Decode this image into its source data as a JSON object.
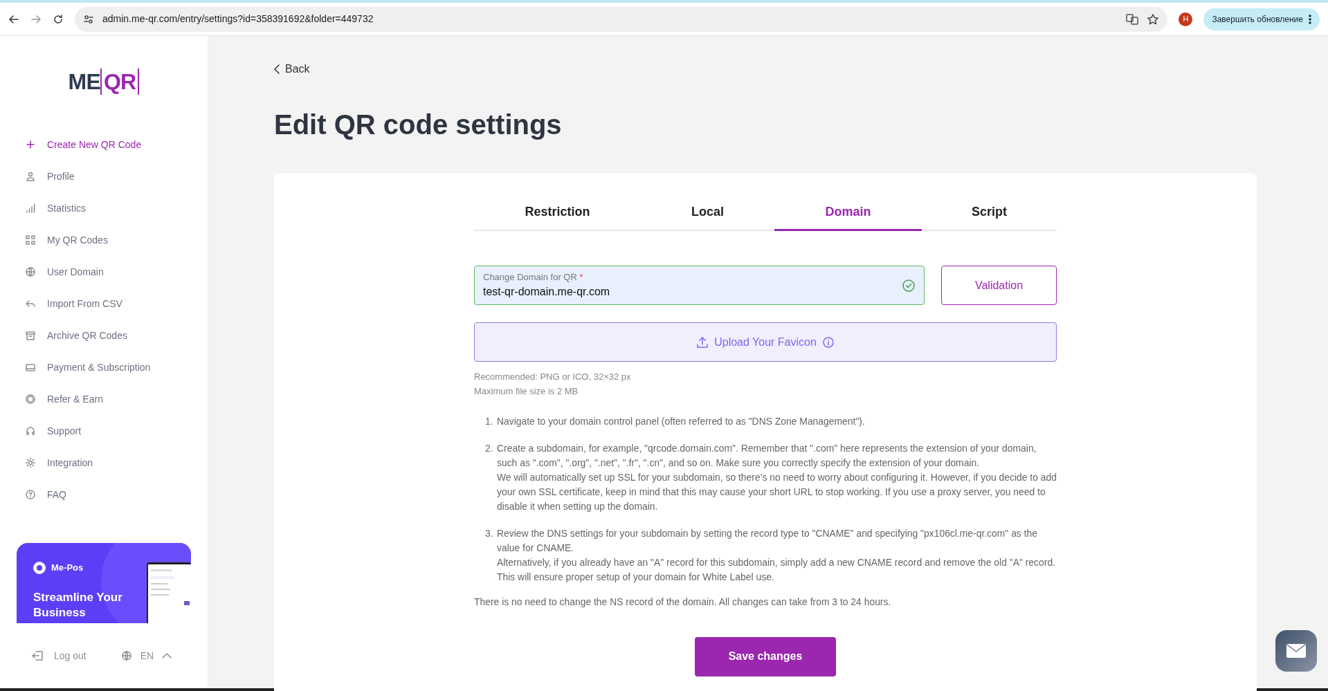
{
  "browser": {
    "url": "admin.me-qr.com/entry/settings?id=358391692&folder=449732",
    "profile_initial": "H",
    "update_button": "Завершить обновление"
  },
  "sidebar": {
    "logo": {
      "left": "ME",
      "right": "QR"
    },
    "items": [
      {
        "label": "Create New QR Code",
        "selected": true
      },
      {
        "label": "Profile",
        "selected": false
      },
      {
        "label": "Statistics",
        "selected": false
      },
      {
        "label": "My QR Codes",
        "selected": false
      },
      {
        "label": "User Domain",
        "selected": false
      },
      {
        "label": "Import From CSV",
        "selected": false
      },
      {
        "label": "Archive QR Codes",
        "selected": false
      },
      {
        "label": "Payment & Subscription",
        "selected": false
      },
      {
        "label": "Refer & Earn",
        "selected": false
      },
      {
        "label": "Support",
        "selected": false
      },
      {
        "label": "Integration",
        "selected": false
      },
      {
        "label": "FAQ",
        "selected": false
      }
    ],
    "promo": {
      "brand": "Me-Pos",
      "headline": "Streamline Your Business"
    },
    "logout": "Log out",
    "language": "EN"
  },
  "back": "Back",
  "title": "Edit QR code settings",
  "tabs": [
    {
      "label": "Restriction",
      "selected": false
    },
    {
      "label": "Local",
      "selected": false
    },
    {
      "label": "Domain",
      "selected": true
    },
    {
      "label": "Script",
      "selected": false
    }
  ],
  "domain_field": {
    "label": "Change Domain for QR",
    "required_mark": "*",
    "value": "test-qr-domain.me-qr.com",
    "valid": true
  },
  "validation_button": "Validation",
  "upload_button": "Upload Your Favicon",
  "upload_notes": [
    "Recommended: PNG or ICO, 32×32 px",
    "Maximum file size is 2 MB"
  ],
  "steps": [
    {
      "number": "1.",
      "paragraphs": [
        "Navigate to your domain control panel (often referred to as \"DNS Zone Management\")."
      ]
    },
    {
      "number": "2.",
      "paragraphs": [
        "Create a subdomain, for example, \"qrcode.domain.com\". Remember that \".com\" here represents the extension of your domain, such as \".com\", \".org\", \".net\", \".fr\", \".cn\", and so on. Make sure you correctly specify the extension of your domain.",
        "We will automatically set up SSL for your subdomain, so there’s no need to worry about configuring it. However, if you decide to add your own SSL certificate, keep in mind that this may cause your short URL to stop working. If you use a proxy server, you need to disable it when setting up the domain."
      ]
    },
    {
      "number": "3.",
      "paragraphs": [
        "Review the DNS settings for your subdomain by setting the record type to \"CNAME\" and specifying \"px106cl.me-qr.com\" as the value for CNAME.",
        "Alternatively, if you already have an \"A\" record for this subdomain, simply add a new CNAME record and remove the old \"A\" record. This will ensure proper setup of your domain for White Label use."
      ]
    }
  ],
  "footer_note": "There is no need to change the NS record of the domain. All changes can take from 3 to 24 hours.",
  "save_button": "Save changes"
}
